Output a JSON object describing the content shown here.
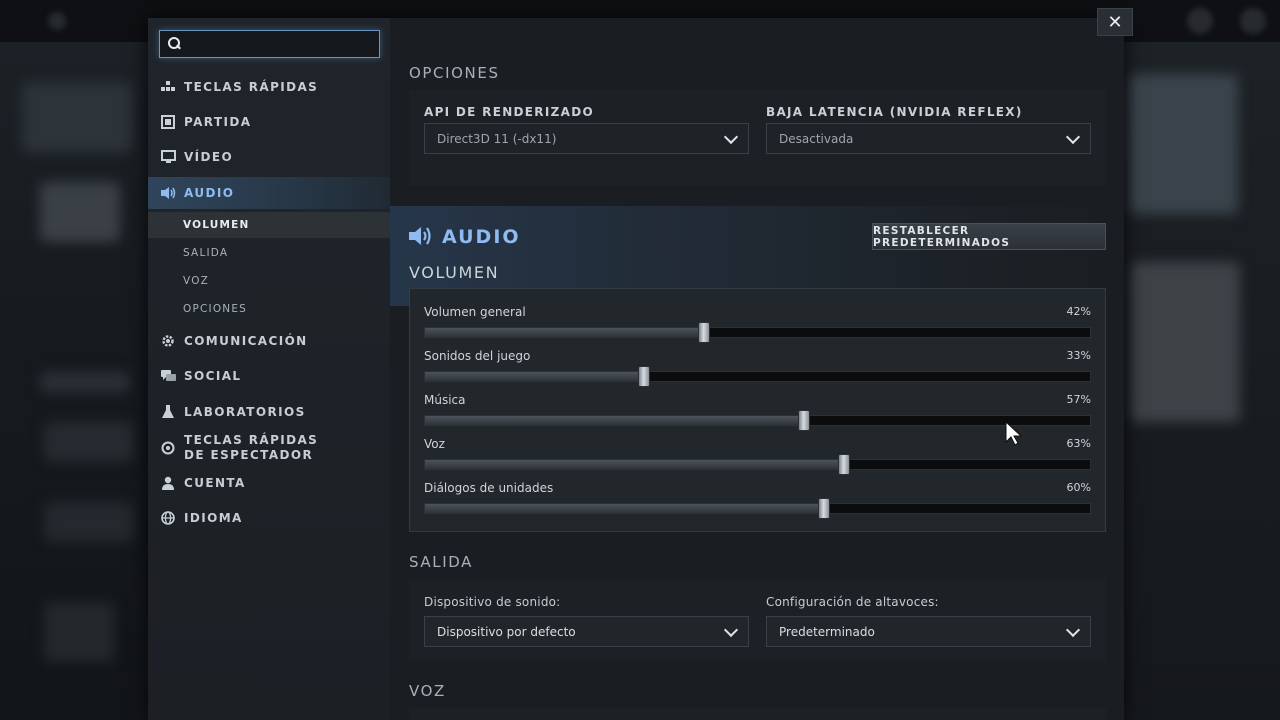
{
  "search": {
    "value": "",
    "placeholder": ""
  },
  "close_label": "✕",
  "nav": {
    "items": [
      {
        "label": "TECLAS RÁPIDAS",
        "icon": "hotkeys-icon"
      },
      {
        "label": "PARTIDA",
        "icon": "game-icon"
      },
      {
        "label": "VÍDEO",
        "icon": "monitor-icon"
      },
      {
        "label": "AUDIO",
        "icon": "speaker-icon",
        "active": true
      },
      {
        "label": "COMUNICACIÓN",
        "icon": "gear-icon"
      },
      {
        "label": "SOCIAL",
        "icon": "chat-icon"
      },
      {
        "label": "LABORATORIOS",
        "icon": "flask-icon"
      },
      {
        "label": "TECLAS RÁPIDAS DE ESPECTADOR",
        "icon": "spectator-icon"
      },
      {
        "label": "CUENTA",
        "icon": "user-icon"
      },
      {
        "label": "IDIOMA",
        "icon": "globe-icon"
      }
    ],
    "audio_sub": [
      {
        "label": "VOLUMEN",
        "active": true
      },
      {
        "label": "SALIDA"
      },
      {
        "label": "VOZ"
      },
      {
        "label": "OPCIONES"
      }
    ]
  },
  "options": {
    "title": "OPCIONES",
    "render_api": {
      "label": "API DE RENDERIZADO",
      "value": "Direct3D 11 (-dx11)"
    },
    "low_latency": {
      "label": "BAJA LATENCIA (NVIDIA REFLEX)",
      "value": "Desactivada"
    }
  },
  "audio": {
    "title": "AUDIO",
    "reset_label": "RESTABLECER PREDETERMINADOS",
    "volume_title": "VOLUMEN",
    "sliders": [
      {
        "label": "Volumen general",
        "percent_text": "42%",
        "value": 0.42
      },
      {
        "label": "Sonidos del juego",
        "percent_text": "33%",
        "value": 0.33
      },
      {
        "label": "Música",
        "percent_text": "57%",
        "value": 0.57
      },
      {
        "label": "Voz",
        "percent_text": "63%",
        "value": 0.63
      },
      {
        "label": "Diálogos de unidades",
        "percent_text": "60%",
        "value": 0.6
      }
    ]
  },
  "output": {
    "title": "SALIDA",
    "device": {
      "label": "Dispositivo de sonido:",
      "value": "Dispositivo por defecto"
    },
    "speakers": {
      "label": "Configuración de altavoces:",
      "value": "Predeterminado"
    }
  },
  "voice": {
    "title": "VOZ"
  },
  "colors": {
    "accent": "#8fbbf0",
    "panel": "#1b1f23",
    "sidebar": "#20252b"
  }
}
